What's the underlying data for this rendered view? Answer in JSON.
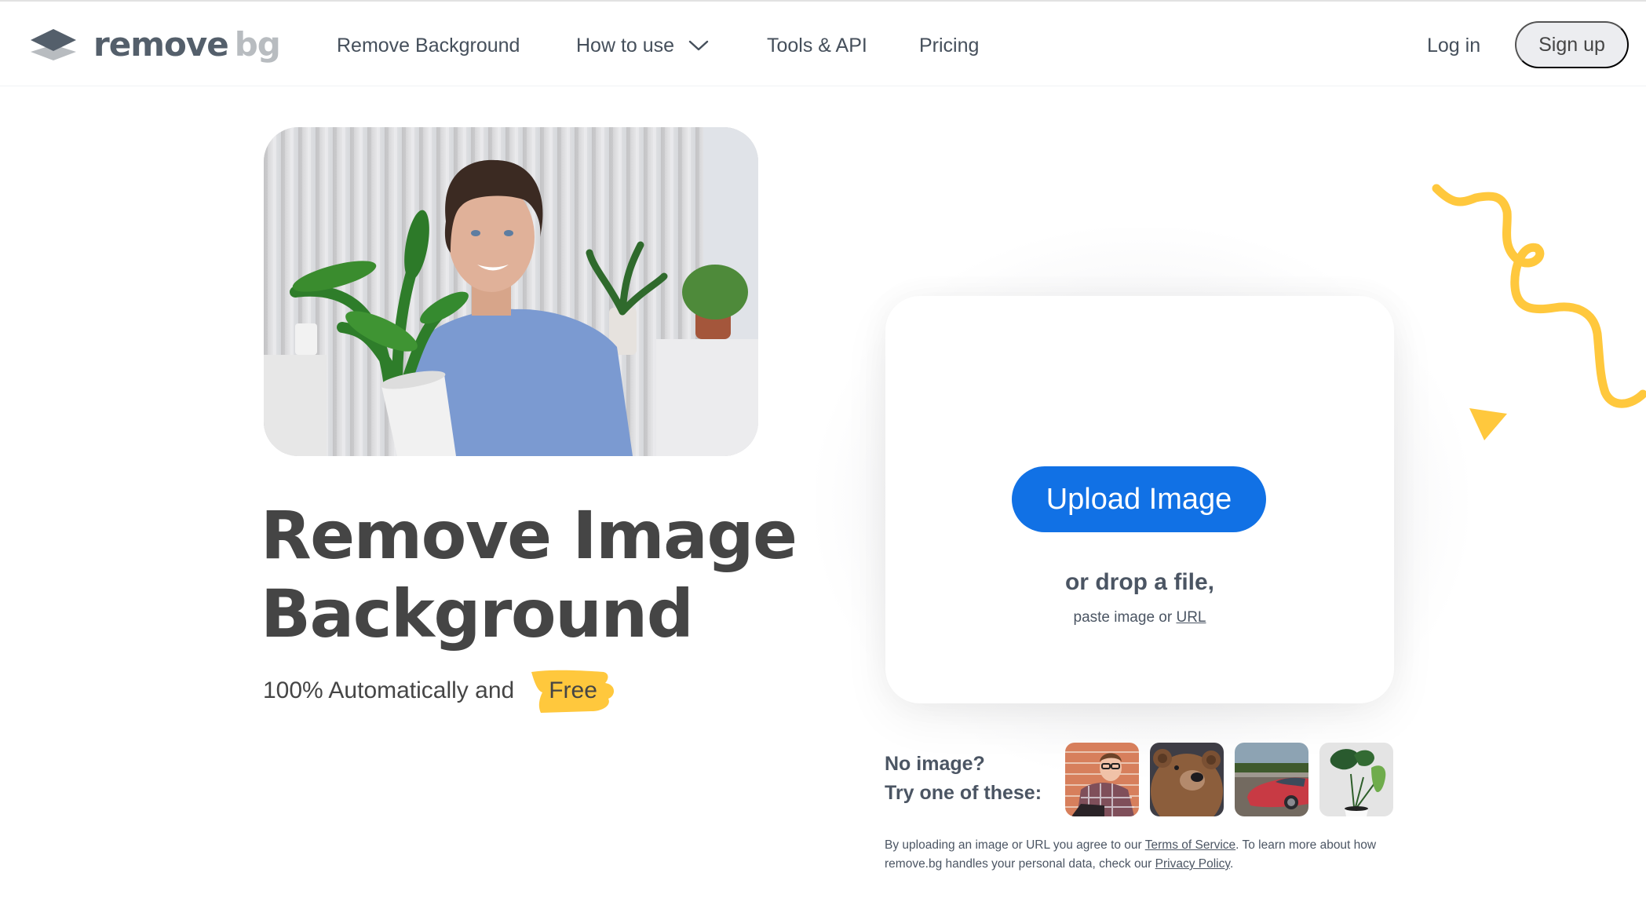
{
  "brand": {
    "logo_word1": "remove",
    "logo_word2": "bg",
    "colors": {
      "logo_dark": "#545f6b",
      "logo_light": "#b8bcc0",
      "accent_blue": "#1171e5",
      "accent_yellow": "#ffc83d",
      "text": "#454545"
    }
  },
  "nav": {
    "items": [
      {
        "label": "Remove Background"
      },
      {
        "label": "How to use",
        "icon": "chevron-down-icon"
      },
      {
        "label": "Tools & API"
      },
      {
        "label": "Pricing"
      }
    ],
    "login_label": "Log in",
    "signup_label": "Sign up"
  },
  "hero": {
    "image_alt": "Man with curly hair holding a potted plant",
    "title_line1": "Remove Image",
    "title_line2": "Background",
    "subtitle": "100% Automatically and",
    "subtitle_highlight": "Free"
  },
  "upload": {
    "button_label": "Upload Image",
    "drop_text": "or drop a file,",
    "paste_prefix": "paste image or",
    "paste_link": "URL"
  },
  "samples": {
    "label_line1": "No image?",
    "label_line2": "Try one of these:",
    "items": [
      {
        "name": "sample-person",
        "alt": "Young man with glasses in plaid shirt against brick wall"
      },
      {
        "name": "sample-bear",
        "alt": "Brown bear"
      },
      {
        "name": "sample-car",
        "alt": "Red sports car"
      },
      {
        "name": "sample-plant",
        "alt": "Monstera plant in pot"
      }
    ]
  },
  "legal": {
    "text1": "By uploading an image or URL you agree to our ",
    "terms_link": "Terms of Service",
    "text2": ". To learn more about how remove.bg handles your personal data, check our ",
    "privacy_link": "Privacy Policy",
    "text3": "."
  }
}
